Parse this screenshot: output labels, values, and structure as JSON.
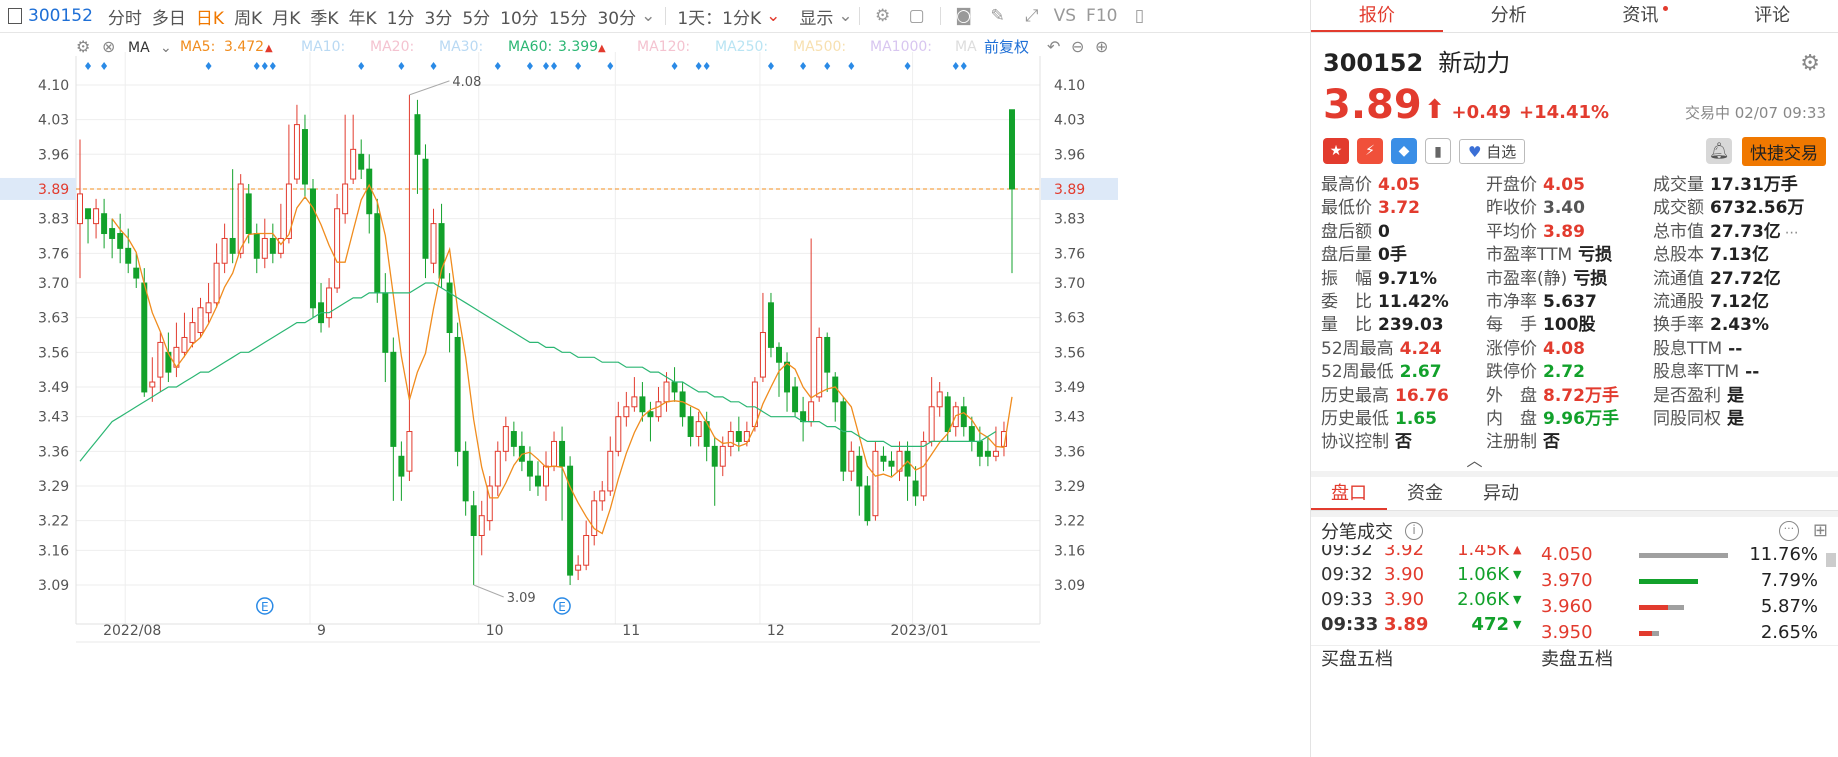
{
  "toolbar": {
    "code": "300152",
    "periods": [
      "分时",
      "多日",
      "日K",
      "周K",
      "月K",
      "季K",
      "年K",
      "1分",
      "3分",
      "5分",
      "10分",
      "15分",
      "30分"
    ],
    "active_period": "日K",
    "range": "1天：1分K",
    "display": "显示",
    "vs": "VS",
    "f10": "F10"
  },
  "indicator": {
    "label": "MA",
    "ma5_label": "MA5:",
    "ma5_value": "3.472",
    "ma10": "MA10:",
    "ma20": "MA20:",
    "ma30": "MA30:",
    "ma60_label": "MA60:",
    "ma60_value": "3.399",
    "ma120": "MA120:",
    "ma250": "MA250:",
    "ma500": "MA500:",
    "ma1000": "MA1000:",
    "ma_more": "MA",
    "adjust": "前复权"
  },
  "chart_data": {
    "type": "candlestick",
    "y_ticks": [
      4.1,
      4.03,
      3.96,
      3.89,
      3.83,
      3.76,
      3.7,
      3.63,
      3.56,
      3.49,
      3.43,
      3.36,
      3.29,
      3.22,
      3.16,
      3.09
    ],
    "ylim": [
      3.035,
      4.15
    ],
    "x_labels": [
      {
        "label": "2022/08",
        "idx": 6
      },
      {
        "label": "9",
        "idx": 29
      },
      {
        "label": "10",
        "idx": 50
      },
      {
        "label": "11",
        "idx": 67
      },
      {
        "label": "12",
        "idx": 85
      },
      {
        "label": "2023/01",
        "idx": 104
      }
    ],
    "current_price": 3.89,
    "current_price_label": "3.89",
    "high_annotation": {
      "label": "4.08",
      "idx": 41,
      "value": 4.08
    },
    "low_annotation": {
      "label": "3.09",
      "idx": 49,
      "value": 3.09
    },
    "event_markers": [
      {
        "label": "E",
        "idx": 23
      },
      {
        "label": "E",
        "idx": 60
      }
    ],
    "markers_idx": [
      1,
      3,
      16,
      22,
      23,
      24,
      35,
      40,
      44,
      52,
      56,
      58,
      59,
      62,
      66,
      74,
      77,
      78,
      86,
      90,
      93,
      96,
      103,
      109,
      110
    ],
    "ohlc": [
      [
        3.82,
        3.88,
        3.99,
        3.71
      ],
      [
        3.85,
        3.83,
        3.85,
        3.78
      ],
      [
        3.82,
        3.85,
        3.87,
        3.79
      ],
      [
        3.84,
        3.8,
        3.87,
        3.77
      ],
      [
        3.81,
        3.79,
        3.83,
        3.75
      ],
      [
        3.8,
        3.77,
        3.84,
        3.74
      ],
      [
        3.77,
        3.74,
        3.81,
        3.72
      ],
      [
        3.73,
        3.71,
        3.76,
        3.69
      ],
      [
        3.7,
        3.48,
        3.73,
        3.47
      ],
      [
        3.49,
        3.5,
        3.55,
        3.46
      ],
      [
        3.51,
        3.58,
        3.6,
        3.48
      ],
      [
        3.56,
        3.52,
        3.6,
        3.5
      ],
      [
        3.53,
        3.57,
        3.62,
        3.51
      ],
      [
        3.56,
        3.59,
        3.64,
        3.55
      ],
      [
        3.58,
        3.62,
        3.65,
        3.57
      ],
      [
        3.6,
        3.65,
        3.67,
        3.59
      ],
      [
        3.64,
        3.66,
        3.7,
        3.62
      ],
      [
        3.66,
        3.74,
        3.78,
        3.65
      ],
      [
        3.74,
        3.79,
        3.82,
        3.72
      ],
      [
        3.79,
        3.76,
        3.93,
        3.74
      ],
      [
        3.76,
        3.9,
        3.92,
        3.75
      ],
      [
        3.88,
        3.8,
        3.9,
        3.78
      ],
      [
        3.8,
        3.75,
        3.82,
        3.72
      ],
      [
        3.75,
        3.79,
        3.83,
        3.73
      ],
      [
        3.79,
        3.76,
        3.82,
        3.74
      ],
      [
        3.76,
        3.79,
        3.86,
        3.75
      ],
      [
        3.79,
        3.9,
        4.02,
        3.78
      ],
      [
        3.91,
        4.02,
        4.06,
        3.9
      ],
      [
        4.01,
        3.9,
        4.04,
        3.87
      ],
      [
        3.89,
        3.65,
        3.91,
        3.63
      ],
      [
        3.66,
        3.62,
        3.7,
        3.6
      ],
      [
        3.63,
        3.69,
        3.71,
        3.61
      ],
      [
        3.69,
        3.85,
        3.88,
        3.68
      ],
      [
        3.84,
        3.9,
        4.04,
        3.82
      ],
      [
        3.91,
        3.97,
        4.04,
        3.9
      ],
      [
        3.96,
        3.93,
        3.99,
        3.91
      ],
      [
        3.93,
        3.84,
        3.96,
        3.8
      ],
      [
        3.84,
        3.68,
        3.87,
        3.66
      ],
      [
        3.68,
        3.56,
        3.72,
        3.5
      ],
      [
        3.56,
        3.37,
        3.59,
        3.26
      ],
      [
        3.35,
        3.31,
        3.38,
        3.26
      ],
      [
        3.32,
        3.4,
        4.08,
        3.3
      ],
      [
        4.04,
        3.96,
        4.07,
        3.88
      ],
      [
        3.95,
        3.75,
        3.98,
        3.71
      ],
      [
        3.74,
        3.82,
        3.85,
        3.72
      ],
      [
        3.82,
        3.71,
        3.86,
        3.69
      ],
      [
        3.7,
        3.6,
        3.72,
        3.56
      ],
      [
        3.59,
        3.36,
        3.62,
        3.33
      ],
      [
        3.36,
        3.26,
        3.38,
        3.23
      ],
      [
        3.25,
        3.19,
        3.28,
        3.09
      ],
      [
        3.19,
        3.23,
        3.26,
        3.15
      ],
      [
        3.22,
        3.29,
        3.31,
        3.2
      ],
      [
        3.29,
        3.36,
        3.38,
        3.27
      ],
      [
        3.36,
        3.41,
        3.43,
        3.34
      ],
      [
        3.4,
        3.37,
        3.42,
        3.35
      ],
      [
        3.37,
        3.34,
        3.4,
        3.32
      ],
      [
        3.34,
        3.31,
        3.37,
        3.28
      ],
      [
        3.31,
        3.29,
        3.34,
        3.27
      ],
      [
        3.29,
        3.33,
        3.36,
        3.26
      ],
      [
        3.33,
        3.38,
        3.4,
        3.32
      ],
      [
        3.38,
        3.33,
        3.41,
        3.22
      ],
      [
        3.33,
        3.11,
        3.35,
        3.09
      ],
      [
        3.12,
        3.13,
        3.15,
        3.1
      ],
      [
        3.13,
        3.19,
        3.22,
        3.12
      ],
      [
        3.19,
        3.26,
        3.28,
        3.17
      ],
      [
        3.26,
        3.28,
        3.3,
        3.24
      ],
      [
        3.28,
        3.36,
        3.39,
        3.27
      ],
      [
        3.36,
        3.43,
        3.46,
        3.35
      ],
      [
        3.43,
        3.45,
        3.48,
        3.41
      ],
      [
        3.45,
        3.47,
        3.51,
        3.44
      ],
      [
        3.47,
        3.44,
        3.5,
        3.42
      ],
      [
        3.44,
        3.43,
        3.46,
        3.38
      ],
      [
        3.43,
        3.46,
        3.49,
        3.42
      ],
      [
        3.46,
        3.5,
        3.52,
        3.44
      ],
      [
        3.5,
        3.48,
        3.53,
        3.46
      ],
      [
        3.48,
        3.43,
        3.5,
        3.41
      ],
      [
        3.43,
        3.39,
        3.45,
        3.37
      ],
      [
        3.39,
        3.42,
        3.44,
        3.37
      ],
      [
        3.42,
        3.37,
        3.44,
        3.34
      ],
      [
        3.37,
        3.33,
        3.39,
        3.25
      ],
      [
        3.33,
        3.37,
        3.39,
        3.31
      ],
      [
        3.37,
        3.4,
        3.42,
        3.35
      ],
      [
        3.4,
        3.38,
        3.43,
        3.36
      ],
      [
        3.38,
        3.4,
        3.42,
        3.37
      ],
      [
        3.41,
        3.5,
        3.51,
        3.4
      ],
      [
        3.51,
        3.6,
        3.68,
        3.5
      ],
      [
        3.66,
        3.57,
        3.68,
        3.55
      ],
      [
        3.57,
        3.54,
        3.58,
        3.47
      ],
      [
        3.54,
        3.48,
        3.56,
        3.44
      ],
      [
        3.49,
        3.44,
        3.51,
        3.43
      ],
      [
        3.44,
        3.42,
        3.47,
        3.38
      ],
      [
        3.42,
        3.46,
        3.79,
        3.41
      ],
      [
        3.47,
        3.59,
        3.61,
        3.46
      ],
      [
        3.59,
        3.52,
        3.6,
        3.48
      ],
      [
        3.51,
        3.46,
        3.52,
        3.42
      ],
      [
        3.46,
        3.32,
        3.47,
        3.3
      ],
      [
        3.32,
        3.36,
        3.38,
        3.3
      ],
      [
        3.35,
        3.29,
        3.37,
        3.23
      ],
      [
        3.29,
        3.22,
        3.31,
        3.21
      ],
      [
        3.23,
        3.36,
        3.38,
        3.22
      ],
      [
        3.35,
        3.34,
        3.37,
        3.32
      ],
      [
        3.34,
        3.33,
        3.36,
        3.31
      ],
      [
        3.32,
        3.36,
        3.38,
        3.3
      ],
      [
        3.36,
        3.31,
        3.38,
        3.26
      ],
      [
        3.3,
        3.27,
        3.33,
        3.25
      ],
      [
        3.27,
        3.38,
        3.4,
        3.26
      ],
      [
        3.38,
        3.45,
        3.51,
        3.37
      ],
      [
        3.45,
        3.48,
        3.5,
        3.43
      ],
      [
        3.47,
        3.4,
        3.48,
        3.38
      ],
      [
        3.41,
        3.45,
        3.46,
        3.39
      ],
      [
        3.45,
        3.41,
        3.47,
        3.39
      ],
      [
        3.41,
        3.38,
        3.43,
        3.36
      ],
      [
        3.38,
        3.35,
        3.41,
        3.33
      ],
      [
        3.36,
        3.35,
        3.39,
        3.33
      ],
      [
        3.35,
        3.36,
        3.41,
        3.34
      ],
      [
        3.37,
        3.4,
        3.42,
        3.35
      ],
      [
        4.05,
        3.89,
        4.05,
        3.72
      ]
    ],
    "ma60": [
      3.34,
      3.36,
      3.38,
      3.4,
      3.42,
      3.43,
      3.44,
      3.45,
      3.46,
      3.47,
      3.48,
      3.49,
      3.49,
      3.5,
      3.51,
      3.52,
      3.52,
      3.53,
      3.54,
      3.55,
      3.56,
      3.56,
      3.57,
      3.58,
      3.59,
      3.6,
      3.61,
      3.62,
      3.62,
      3.63,
      3.64,
      3.64,
      3.65,
      3.66,
      3.67,
      3.67,
      3.68,
      3.68,
      3.68,
      3.68,
      3.68,
      3.68,
      3.69,
      3.7,
      3.7,
      3.69,
      3.68,
      3.67,
      3.66,
      3.65,
      3.64,
      3.63,
      3.62,
      3.61,
      3.6,
      3.59,
      3.58,
      3.58,
      3.57,
      3.57,
      3.56,
      3.56,
      3.55,
      3.55,
      3.55,
      3.54,
      3.54,
      3.54,
      3.53,
      3.53,
      3.53,
      3.52,
      3.52,
      3.51,
      3.5,
      3.5,
      3.49,
      3.48,
      3.48,
      3.47,
      3.47,
      3.46,
      3.46,
      3.45,
      3.45,
      3.44,
      3.43,
      3.43,
      3.43,
      3.43,
      3.42,
      3.42,
      3.42,
      3.41,
      3.41,
      3.4,
      3.4,
      3.39,
      3.38,
      3.38,
      3.38,
      3.37,
      3.37,
      3.37,
      3.37,
      3.37,
      3.38,
      3.38,
      3.38,
      3.38,
      3.38,
      3.38,
      3.38,
      3.39,
      3.4
    ]
  },
  "quote_tabs": [
    "报价",
    "分析",
    "资讯",
    "评论"
  ],
  "quote": {
    "code": "300152",
    "name": "新动力",
    "price": "3.89",
    "arrow": "⬆",
    "change": "+0.49",
    "change_pct": "+14.41%",
    "status": "交易中 02/07 09:33",
    "watch": "自选",
    "quick_trade": "快捷交易",
    "stats": [
      [
        {
          "l": "最高价",
          "v": "4.05",
          "c": "red"
        },
        {
          "l": "开盘价",
          "v": "4.05",
          "c": "red"
        },
        {
          "l": "成交量",
          "v": "17.31万手",
          "c": "blk"
        }
      ],
      [
        {
          "l": "最低价",
          "v": "3.72",
          "c": "red"
        },
        {
          "l": "昨收价",
          "v": "3.40",
          "c": "gray"
        },
        {
          "l": "成交额",
          "v": "6732.56万",
          "c": "blk"
        }
      ],
      [
        {
          "l": "盘后额",
          "v": "0",
          "c": "blk"
        },
        {
          "l": "平均价",
          "v": "3.89",
          "c": "red"
        },
        {
          "l": "总市值",
          "v": "27.73亿",
          "c": "blk"
        }
      ],
      [
        {
          "l": "盘后量",
          "v": "0手",
          "c": "blk"
        },
        {
          "l": "市盈率TTM",
          "v": "亏损",
          "c": "blk"
        },
        {
          "l": "总股本",
          "v": "7.13亿",
          "c": "blk"
        }
      ],
      [
        {
          "l": "振　幅",
          "v": "9.71%",
          "c": "blk"
        },
        {
          "l": "市盈率(静)",
          "v": "亏损",
          "c": "blk"
        },
        {
          "l": "流通值",
          "v": "27.72亿",
          "c": "blk"
        }
      ],
      [
        {
          "l": "委　比",
          "v": "11.42%",
          "c": "blk"
        },
        {
          "l": "市净率",
          "v": "5.637",
          "c": "blk"
        },
        {
          "l": "流通股",
          "v": "7.12亿",
          "c": "blk"
        }
      ],
      [
        {
          "l": "量　比",
          "v": "239.03",
          "c": "blk"
        },
        {
          "l": "每　手",
          "v": "100股",
          "c": "blk"
        },
        {
          "l": "换手率",
          "v": "2.43%",
          "c": "blk"
        }
      ],
      [
        {
          "l": "52周最高",
          "v": "4.24",
          "c": "red"
        },
        {
          "l": "涨停价",
          "v": "4.08",
          "c": "red"
        },
        {
          "l": "股息TTM",
          "v": "--",
          "c": "blk"
        }
      ],
      [
        {
          "l": "52周最低",
          "v": "2.67",
          "c": "grn"
        },
        {
          "l": "跌停价",
          "v": "2.72",
          "c": "grn"
        },
        {
          "l": "股息率TTM",
          "v": "--",
          "c": "blk"
        }
      ],
      [
        {
          "l": "历史最高",
          "v": "16.76",
          "c": "red"
        },
        {
          "l": "外　盘",
          "v": "8.72万手",
          "c": "red"
        },
        {
          "l": "是否盈利",
          "v": "是",
          "c": "blk"
        }
      ],
      [
        {
          "l": "历史最低",
          "v": "1.65",
          "c": "grn"
        },
        {
          "l": "内　盘",
          "v": "9.96万手",
          "c": "grn"
        },
        {
          "l": "同股同权",
          "v": "是",
          "c": "blk"
        }
      ],
      [
        {
          "l": "协议控制",
          "v": "否",
          "c": "blk"
        },
        {
          "l": "注册制",
          "v": "否",
          "c": "blk"
        },
        {
          "l": "",
          "v": "",
          "c": "blk"
        }
      ]
    ]
  },
  "sub_tabs": [
    "盘口",
    "资金",
    "异动"
  ],
  "ticks_title": "分笔成交",
  "ticks": [
    {
      "time": "09:32",
      "price": "3.92",
      "qty": "1.45K",
      "dir": "up"
    },
    {
      "time": "09:32",
      "price": "3.90",
      "qty": "1.06K",
      "dir": "down"
    },
    {
      "time": "09:33",
      "price": "3.90",
      "qty": "2.06K",
      "dir": "down"
    },
    {
      "time": "09:33",
      "price": "3.89",
      "qty": "472",
      "dir": "down"
    }
  ],
  "price_dist": [
    {
      "price": "4.050",
      "pct": "11.76%",
      "frac": 0.1176,
      "color": "gray"
    },
    {
      "price": "3.970",
      "pct": "7.79%",
      "frac": 0.0779,
      "color": "green"
    },
    {
      "price": "3.960",
      "pct": "5.87%",
      "frac": 0.0587,
      "color": "red"
    },
    {
      "price": "3.950",
      "pct": "2.65%",
      "frac": 0.0265,
      "color": "red"
    }
  ],
  "order_book": {
    "buy": "买盘五档",
    "sell": "卖盘五档"
  },
  "colors": {
    "up": "#e23b2e",
    "down": "#12a12b",
    "ma5": "#f08c1e",
    "ma60": "#2bb673",
    "accent": "#f07800",
    "blue": "#1e6fd6"
  }
}
